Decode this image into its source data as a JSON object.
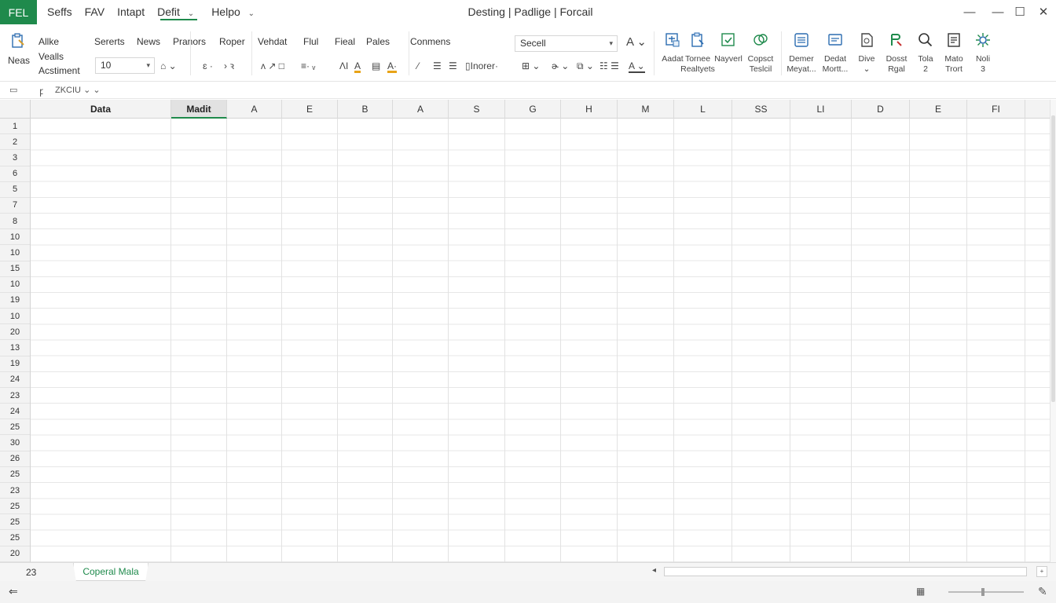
{
  "app": {
    "badge": "FEL",
    "title": "Desting | Padlige | Forcail"
  },
  "menu": [
    {
      "label": "Seffs"
    },
    {
      "label": "FAV"
    },
    {
      "label": "Intapt"
    },
    {
      "label": "Defit",
      "active": true
    },
    {
      "label": "Helpo"
    }
  ],
  "ribbon": {
    "left_group": {
      "top": "Neas",
      "line1": "Allke",
      "line2": "Vealls",
      "line3": "Acstiment"
    },
    "tabs_row": [
      "Sererts",
      "News",
      "Pranors",
      "Roper",
      "Vehdat",
      "Flul",
      "Fieal",
      "Pales",
      "Conmens"
    ],
    "font_size": "10",
    "style_value": "Secell",
    "inline_tools": [
      "ɛ",
      "·",
      "›",
      "ꝛ",
      "ᴧ",
      "↗",
      "□",
      "≡",
      "ᵥ",
      "ɅI",
      "A",
      "▤",
      "A",
      "⁄",
      "☰",
      "☰"
    ],
    "inorer_label": "Inorer",
    "big_buttons": [
      {
        "icon": "add-table-icon",
        "line1": "Aadat",
        "line2": ""
      },
      {
        "icon": "clipboard-icon",
        "line1": "Tornee",
        "line2": "Realtyets"
      },
      {
        "icon": "save-sheet-icon",
        "line1": "Nayverl",
        "line2": ""
      },
      {
        "icon": "link-icon",
        "line1": "Copsct",
        "line2": "Teslcil"
      },
      {
        "icon": "database-icon",
        "line1": "Demer",
        "line2": "Meyat..."
      },
      {
        "icon": "card-icon",
        "line1": "Dedat",
        "line2": "Mortt..."
      },
      {
        "icon": "document-icon",
        "line1": "Dive",
        "line2": ""
      },
      {
        "icon": "paint-icon",
        "line1": "Dosst",
        "line2": "Rgal"
      },
      {
        "icon": "search-icon",
        "line1": "Tola",
        "line2": "2"
      },
      {
        "icon": "form-icon",
        "line1": "Mato",
        "line2": "Trort"
      },
      {
        "icon": "settings-icon",
        "line1": "Noli",
        "line2": "3"
      }
    ]
  },
  "formula_bar": {
    "name_box": "▭",
    "fx": "ꝼ",
    "value": "ZKCIU"
  },
  "grid": {
    "columns": [
      "Data",
      "Madit",
      "A",
      "E",
      "B",
      "A",
      "S",
      "G",
      "H",
      "M",
      "L",
      "SS",
      "LI",
      "D",
      "E",
      "FI"
    ],
    "rows": [
      "1",
      "2",
      "3",
      "6",
      "5",
      "7",
      "8",
      "10",
      "10",
      "15",
      "10",
      "19",
      "10",
      "20",
      "13",
      "19",
      "24",
      "23",
      "24",
      "25",
      "30",
      "26",
      "25",
      "23",
      "25",
      "25",
      "25",
      "20"
    ]
  },
  "sheet": {
    "count": "23",
    "tab": "Coperal Mala"
  },
  "colors": {
    "accent": "#1f8a4c"
  }
}
